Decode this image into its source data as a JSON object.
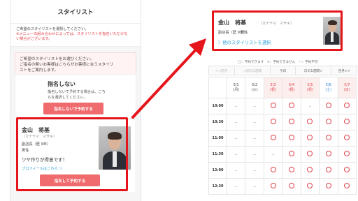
{
  "left": {
    "title": "スタイリスト",
    "note_line1": "ご希望のスタイリストを選択してください。",
    "note_line2": "※メニューの組み合わせによっては、スタイリストを指名いただけな",
    "note_line3": "い場合がございます。",
    "banner_line1": "ご希望のスタイリストをお選びください。",
    "banner_line2": "ご指名の無いお客様はこちらがお客様に合うスタイリ",
    "banner_line3": "ストをご案内します。",
    "no_nomination": {
      "title": "指名しない",
      "desc_line1": "指名しないで予約する場合は、こち",
      "desc_line2": "らを選択してください。",
      "button": "指名しないで予約する"
    },
    "stylist": {
      "name": "金山　将基",
      "kana": "（カナヤマ　マサキ）",
      "role": "副店長（歴 9年）",
      "gender": "男性",
      "catch": "ツヤ作りが得意です！",
      "profile_link": "プロフィールはこちら ＞",
      "button": "指名して予約する"
    }
  },
  "right": {
    "stylist": {
      "name": "金山　将基",
      "kana": "（カナヤマ　マサキ）",
      "role": "副店長（歴 9年）",
      "gender": "男性",
      "other_link": "〉他のスタイリストを選択"
    },
    "legend": "◯：予約できます　✕：予約できません　－：予約不可",
    "nav": [
      "<<前月",
      "＜前の1週間",
      "今日",
      "次の1週間＞",
      "翌月>>"
    ],
    "days": [
      {
        "date": "5/1",
        "dow": "(月)",
        "type": "normal"
      },
      {
        "date": "5/2",
        "dow": "(火)",
        "type": "normal"
      },
      {
        "date": "5/3",
        "dow": "(祝)",
        "type": "holiday"
      },
      {
        "date": "5/4",
        "dow": "(祝)",
        "type": "holiday"
      },
      {
        "date": "5/5",
        "dow": "(祝)",
        "type": "holiday"
      },
      {
        "date": "5/6",
        "dow": "(土)",
        "type": "sat"
      },
      {
        "date": "5/7",
        "dow": "(日)",
        "type": "sun"
      }
    ],
    "rows": [
      {
        "time": "10:00",
        "cells": [
          "－",
          "－",
          "◯",
          "◯",
          "・",
          "◯",
          "◯"
        ]
      },
      {
        "time": "10:30",
        "cells": [
          "－",
          "－",
          "◯",
          "◯",
          "◯",
          "◯",
          "◯"
        ]
      },
      {
        "time": "11:00",
        "cells": [
          "－",
          "－",
          "◯",
          "◯",
          "◯",
          "◯",
          "◯"
        ]
      },
      {
        "time": "11:30",
        "cells": [
          "－",
          "－",
          "・",
          "◯",
          "◯",
          "◯",
          "◯"
        ]
      },
      {
        "time": "12:00",
        "cells": [
          "－",
          "－",
          "◯",
          "◯",
          "◯",
          "◯",
          "◯"
        ]
      },
      {
        "time": "12:30",
        "cells": [
          "－",
          "－",
          "◯",
          "◯",
          "◯",
          "◯",
          "◯"
        ]
      }
    ]
  }
}
